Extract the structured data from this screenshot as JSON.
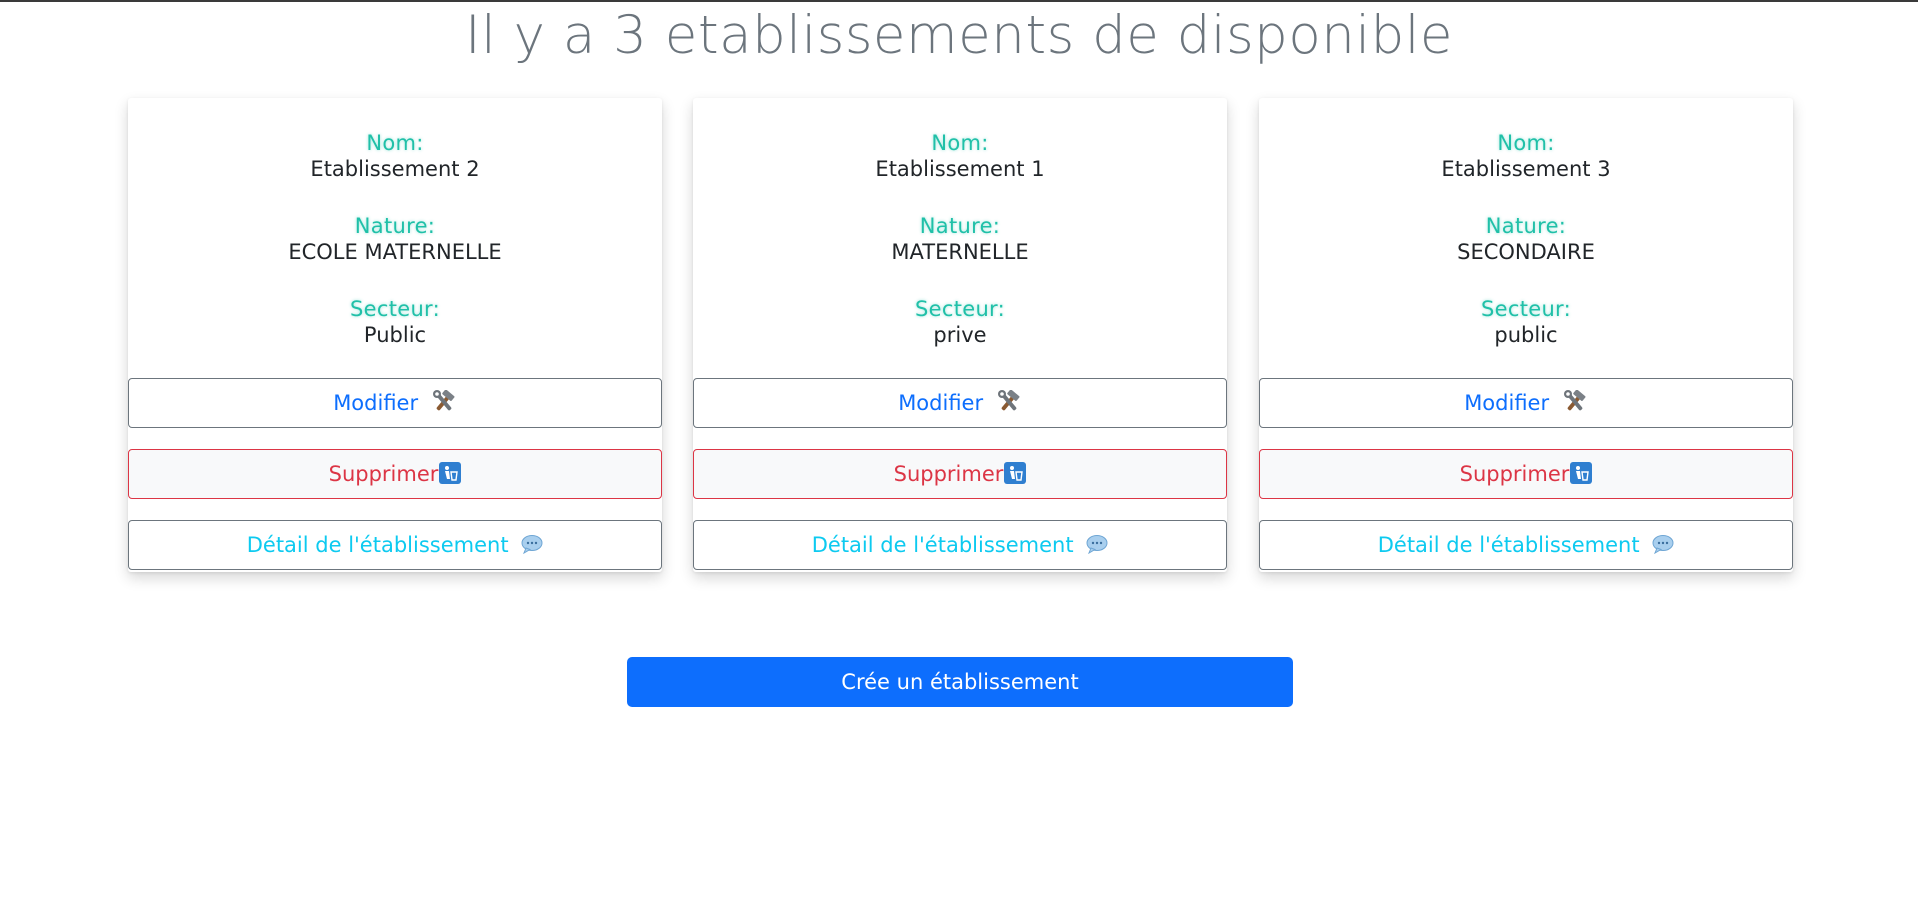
{
  "page": {
    "title": "Il y a 3 etablissements de disponible"
  },
  "labels": {
    "nom": "Nom:",
    "nature": "Nature:",
    "secteur": "Secteur:"
  },
  "cards": [
    {
      "nom": "Etablissement 2",
      "nature": "ECOLE MATERNELLE",
      "secteur": "Public",
      "modifier_label": "Modifier",
      "supprimer_label": "Supprimer",
      "detail_label": "Détail de l'établissement"
    },
    {
      "nom": "Etablissement 1",
      "nature": "MATERNELLE",
      "secteur": "prive",
      "modifier_label": "Modifier",
      "supprimer_label": "Supprimer",
      "detail_label": "Détail de l'établissement"
    },
    {
      "nom": "Etablissement 3",
      "nature": "SECONDAIRE",
      "secteur": "public",
      "modifier_label": "Modifier",
      "supprimer_label": "Supprimer",
      "detail_label": "Détail de l'établissement"
    }
  ],
  "actions": {
    "create_label": "Crée un établissement"
  },
  "icons": {
    "modifier": "hammer-and-wrench-icon",
    "supprimer": "trash-icon",
    "detail": "speech-bubble-icon"
  },
  "colors": {
    "primary": "#0d6efd",
    "danger": "#dc3545",
    "info": "#0dcaf0",
    "label_highlight": "#20c0a8",
    "title": "#6c757d"
  }
}
